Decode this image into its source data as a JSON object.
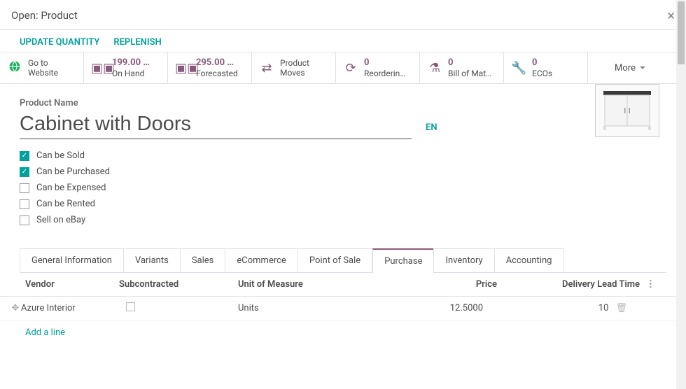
{
  "modal": {
    "title": "Open: Product"
  },
  "header_actions": {
    "update_quantity": "UPDATE QUANTITY",
    "replenish": "REPLENISH"
  },
  "stat_buttons": {
    "website": {
      "line1": "Go to",
      "line2": "Website"
    },
    "onhand": {
      "value": "199.00 …",
      "label": "On Hand"
    },
    "forecasted": {
      "value": "295.00 …",
      "label": "Forecasted"
    },
    "moves": {
      "line1": "Product",
      "line2": "Moves"
    },
    "reordering": {
      "value": "0",
      "label": "Reorderin…"
    },
    "bom": {
      "value": "0",
      "label": "Bill of Mat…"
    },
    "ecos": {
      "value": "0",
      "label": "ECOs"
    },
    "more": "More"
  },
  "product": {
    "name_label": "Product Name",
    "name": "Cabinet with Doors",
    "lang": "EN",
    "flags": {
      "can_be_sold": "Can be Sold",
      "can_be_purchased": "Can be Purchased",
      "can_be_expensed": "Can be Expensed",
      "can_be_rented": "Can be Rented",
      "sell_on_ebay": "Sell on eBay"
    }
  },
  "tabs": {
    "general": "General Information",
    "variants": "Variants",
    "sales": "Sales",
    "ecommerce": "eCommerce",
    "pos": "Point of Sale",
    "purchase": "Purchase",
    "inventory": "Inventory",
    "accounting": "Accounting"
  },
  "grid": {
    "columns": {
      "vendor": "Vendor",
      "subcontracted": "Subcontracted",
      "uom": "Unit of Measure",
      "price": "Price",
      "lead": "Delivery Lead Time"
    },
    "row": {
      "vendor": "Azure Interior",
      "uom": "Units",
      "price": "12.5000",
      "lead": "10"
    },
    "add_line": "Add a line"
  }
}
